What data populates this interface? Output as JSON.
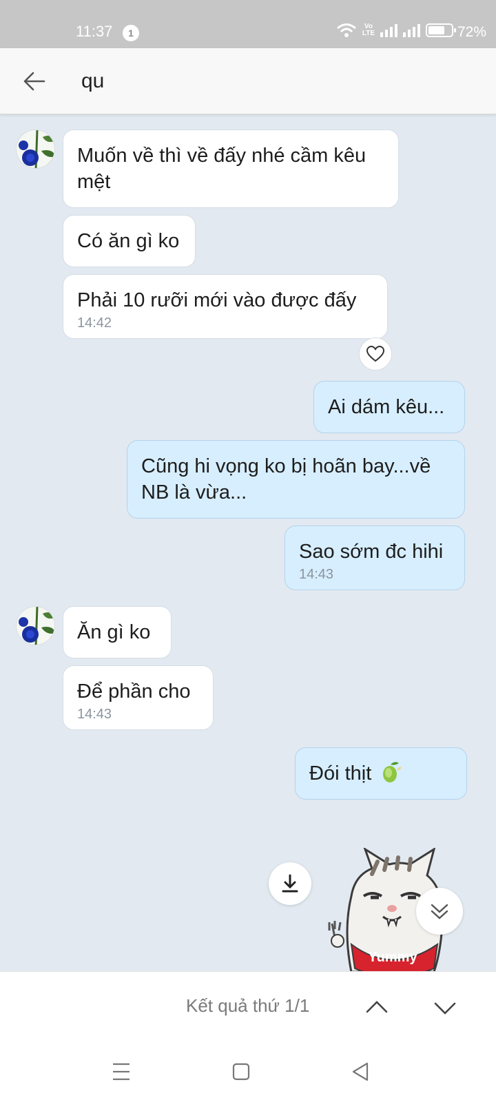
{
  "status_bar": {
    "time": "11:37",
    "notification_count": "1",
    "volte_top": "Vo",
    "volte_bottom": "LTE",
    "battery_percent": "72%",
    "battery_level": 0.72
  },
  "search": {
    "query": "qu"
  },
  "messages": [
    {
      "side": "in",
      "text": "Muốn về thì về đấy nhé cầm kêu mệt",
      "time": ""
    },
    {
      "side": "in",
      "text": "Có ăn gì ko",
      "time": ""
    },
    {
      "side": "in",
      "text": "Phải 10 rưỡi mới vào được đấy",
      "time": "14:42"
    },
    {
      "side": "out",
      "text": "Ai dám kêu...",
      "time": ""
    },
    {
      "side": "out",
      "text": "Cũng hi vọng ko bị hoãn bay...về NB là vừa...",
      "time": ""
    },
    {
      "side": "out",
      "text": "Sao sớm đc hihi",
      "time": "14:43"
    },
    {
      "side": "in",
      "text": "Ăn gì ko",
      "time": ""
    },
    {
      "side": "in",
      "text": "Để phần cho",
      "time": "14:43"
    },
    {
      "side": "out",
      "text": "Đói thịt",
      "time": ""
    }
  ],
  "sticker": {
    "label": "Yummy"
  },
  "search_results": {
    "label": "Kết quả thứ 1/1"
  },
  "colors": {
    "chat_background": "#e2e9f1",
    "incoming_bubble": "#ffffff",
    "outgoing_bubble": "#d7eefe",
    "status_bar": "#c6c6c6"
  },
  "icons": {
    "back": "arrow-left-icon",
    "heart": "heart-icon",
    "download": "download-icon",
    "scroll_down": "double-chevron-down-icon",
    "prev": "chevron-up-icon",
    "next": "chevron-down-icon",
    "menu": "menu-icon",
    "home": "square-icon",
    "back_nav": "triangle-back-icon"
  }
}
